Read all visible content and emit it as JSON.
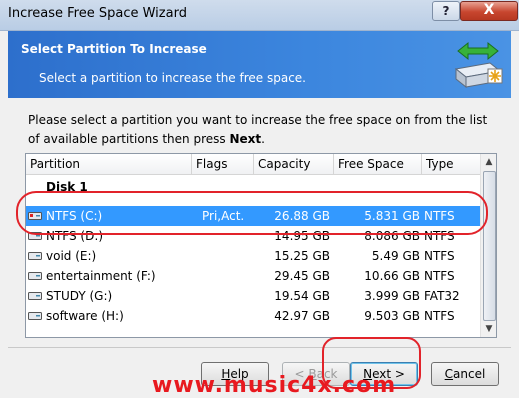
{
  "window": {
    "title": "Increase Free Space Wizard",
    "help_label": "?",
    "close_label": "X"
  },
  "header": {
    "title": "Select Partition To Increase",
    "subtitle": "Select a partition to increase the free space.",
    "icon": "hard-drive-arrows-icon"
  },
  "intro": {
    "text_before": "Please select a partition you want to increase the free space on from the list of available partitions then press ",
    "bold": "Next",
    "text_after": "."
  },
  "table": {
    "columns": [
      "Partition",
      "Flags",
      "Capacity",
      "Free Space",
      "Type"
    ],
    "disk_label": "Disk 1",
    "rows": [
      {
        "name": "NTFS (C:)",
        "flags": "Pri,Act.",
        "capacity": "26.88 GB",
        "free": "5.831 GB",
        "type": "NTFS",
        "selected": true
      },
      {
        "name": "NTFS (D:)",
        "flags": "",
        "capacity": "14.95 GB",
        "free": "8.086 GB",
        "type": "NTFS",
        "selected": false
      },
      {
        "name": "void (E:)",
        "flags": "",
        "capacity": "15.25 GB",
        "free": "5.49 GB",
        "type": "NTFS",
        "selected": false
      },
      {
        "name": "entertainment (F:)",
        "flags": "",
        "capacity": "29.45 GB",
        "free": "10.66 GB",
        "type": "NTFS",
        "selected": false
      },
      {
        "name": "STUDY (G:)",
        "flags": "",
        "capacity": "19.54 GB",
        "free": "3.999 GB",
        "type": "FAT32",
        "selected": false
      },
      {
        "name": "software (H:)",
        "flags": "",
        "capacity": "42.97 GB",
        "free": "9.503 GB",
        "type": "NTFS",
        "selected": false
      }
    ]
  },
  "buttons": {
    "help": {
      "u": "H",
      "rest": "elp"
    },
    "back": {
      "pre": "< ",
      "u": "B",
      "rest": "ack"
    },
    "next": {
      "u": "N",
      "rest": "ext >"
    },
    "cancel": {
      "u": "C",
      "rest": "ancel"
    }
  },
  "watermark": "www.music4x.com",
  "colors": {
    "header_blue": "#3c86de",
    "selection": "#3399ff",
    "annotation_red": "#e2232a"
  }
}
